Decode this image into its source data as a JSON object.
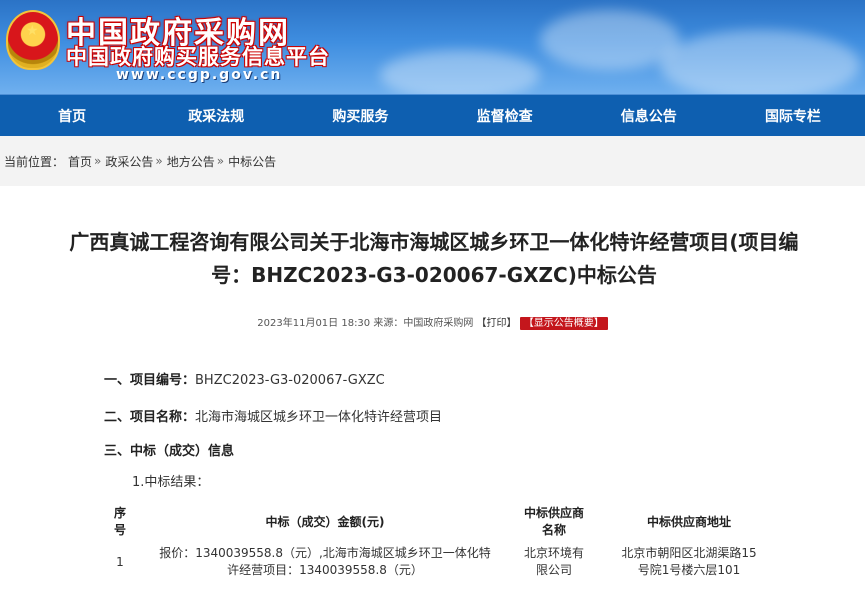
{
  "header": {
    "title_main": "中国政府采购网",
    "title_sub": "中国政府购买服务信息平台",
    "url_text": "www.ccgp.gov.cn"
  },
  "nav": {
    "items": [
      "首页",
      "政采法规",
      "购买服务",
      "监督检查",
      "信息公告",
      "国际专栏"
    ]
  },
  "breadcrumb": {
    "prefix": "当前位置：",
    "items": [
      "首页",
      "政采公告",
      "地方公告",
      "中标公告"
    ],
    "separator": "»"
  },
  "article": {
    "title_line1": "广西真诚工程咨询有限公司关于北海市海城区城乡环卫一体化特许经营项目(项目编",
    "title_line2": "号：BHZC2023-G3-020067-GXZC)中标公告",
    "date": "2023年11月01日 18:30",
    "source_label": "来源：",
    "source": "中国政府采购网",
    "print_label": "【打印】",
    "summary_label": "【显示公告概要】",
    "sec1_label": "一、项目编号：",
    "sec1_value": "BHZC2023-G3-020067-GXZC",
    "sec2_label": "二、项目名称：",
    "sec2_value": "北海市海城区城乡环卫一体化特许经营项目",
    "sec3_label": "三、中标（成交）信息",
    "sub1": "1.中标结果："
  },
  "table": {
    "headers": {
      "col1": [
        "序",
        "号"
      ],
      "col2": "中标（成交）金额(元)",
      "col3": [
        "中标供应商",
        "名称"
      ],
      "col4": "中标供应商地址"
    },
    "row1": {
      "col1": "1",
      "col2_line1": "报价：1340039558.8（元）,北海市海城区城乡环卫一体化特",
      "col2_line2": "许经营项目：1340039558.8（元）",
      "col3_line1": "北京环境有",
      "col3_line2": "限公司",
      "col4_line1": "北京市朝阳区北湖渠路15",
      "col4_line2": "号院1号楼六层101"
    }
  },
  "colors": {
    "nav_bg": "#0e5fb0",
    "summary_bg": "#c4161c",
    "breadcrumb_bg": "#f3f3f3"
  }
}
